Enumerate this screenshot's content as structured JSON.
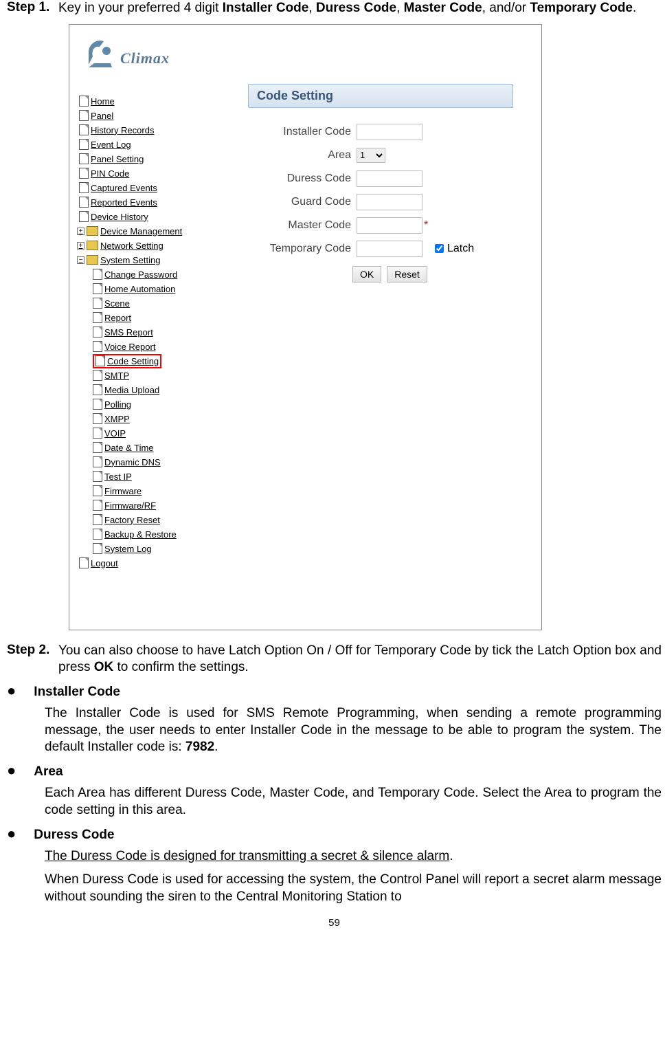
{
  "steps": {
    "s1_label": "Step 1.",
    "s1_text_a": "Key in your preferred 4 digit ",
    "s1_b1": "Installer Code",
    "s1_sep1": ", ",
    "s1_b2": "Duress Code",
    "s1_sep2": ", ",
    "s1_b3": "Master Code",
    "s1_sep3": ", and/or ",
    "s1_b4": "Temporary Code",
    "s1_end": ".",
    "s2_label": "Step 2.",
    "s2_text_a": "You can also choose to have Latch Option On / Off for Temporary Code by tick the Latch Option box and press ",
    "s2_bold": "OK",
    "s2_text_b": " to confirm the settings."
  },
  "logo_text": "Climax",
  "nav": {
    "home": "Home",
    "panel": "Panel",
    "history": "History Records",
    "eventlog": "Event Log",
    "panelsetting": "Panel Setting",
    "pin": "PIN Code",
    "captured": "Captured Events",
    "reported": "Reported Events",
    "devhist": "Device History",
    "devmgmt": "Device Management",
    "netset": "Network Setting",
    "sysset": "System Setting",
    "changepw": "Change Password",
    "homeauto": "Home Automation",
    "scene": "Scene",
    "report": "Report",
    "smsreport": "SMS Report",
    "voicereport": "Voice Report",
    "codesetting": "Code Setting",
    "smtp": "SMTP",
    "media": "Media Upload",
    "polling": "Polling",
    "xmpp": "XMPP",
    "voip": "VOIP",
    "datetime": "Date & Time",
    "ddns": "Dynamic DNS",
    "testip": "Test IP",
    "fw": "Firmware",
    "fwrf": "Firmware/RF",
    "factory": "Factory Reset",
    "backup": "Backup & Restore",
    "syslog": "System Log",
    "logout": "Logout"
  },
  "panel": {
    "heading": "Code Setting",
    "installer": "Installer Code",
    "area": "Area",
    "area_value": "1",
    "duress": "Duress Code",
    "guard": "Guard Code",
    "master": "Master Code",
    "temporary": "Temporary Code",
    "latch": "Latch",
    "ok": "OK",
    "reset": "Reset"
  },
  "bullets": {
    "installer_head": "Installer Code",
    "installer_body_a": "The Installer Code is used for SMS Remote Programming, when sending a remote programming message, the user needs to enter Installer Code in the message to be able to program the system. The default Installer code is: ",
    "installer_code": "7982",
    "installer_body_b": ".",
    "area_head": "Area",
    "area_body": "Each Area has different Duress Code, Master Code, and Temporary Code. Select the Area to program the code setting in this area.",
    "duress_head": "Duress Code",
    "duress_line": "The Duress Code is designed for transmitting a secret & silence alarm",
    "duress_dot": ".",
    "duress_body": "When Duress Code is used for accessing the system, the Control Panel will report a secret alarm message without sounding the siren to the Central Monitoring Station to"
  },
  "page_number": "59"
}
